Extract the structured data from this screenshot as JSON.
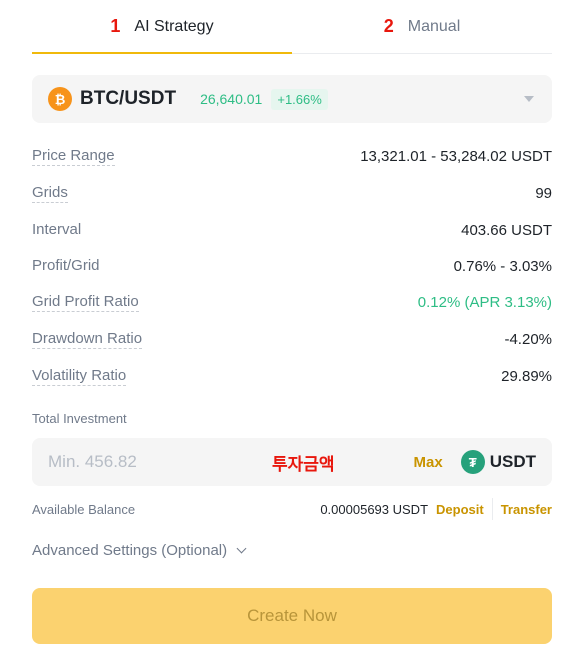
{
  "tabs": [
    {
      "number": "1",
      "label": "AI Strategy",
      "active": true
    },
    {
      "number": "2",
      "label": "Manual",
      "active": false
    }
  ],
  "pair": {
    "coin_icon": "bitcoin-icon",
    "coin_symbol": "₿",
    "name": "BTC/USDT",
    "price": "26,640.01",
    "change": "+1.66%",
    "colors": {
      "up": "#2ebd85",
      "coin": "#f7931a"
    }
  },
  "params": [
    {
      "label": "Price Range",
      "value": "13,321.01 - 53,284.02 USDT",
      "dashed": true,
      "green": false
    },
    {
      "label": "Grids",
      "value": "99",
      "dashed": true,
      "green": false
    },
    {
      "label": "Interval",
      "value": "403.66 USDT",
      "dashed": false,
      "green": false
    },
    {
      "label": "Profit/Grid",
      "value": "0.76% - 3.03%",
      "dashed": false,
      "green": false
    },
    {
      "label": "Grid Profit Ratio",
      "value": "0.12% (APR 3.13%)",
      "dashed": true,
      "green": true
    },
    {
      "label": "Drawdown Ratio",
      "value": "-4.20%",
      "dashed": true,
      "green": false
    },
    {
      "label": "Volatility Ratio",
      "value": "29.89%",
      "dashed": true,
      "green": false
    }
  ],
  "investment": {
    "label": "Total Investment",
    "placeholder": "Min. 456.82",
    "value": "",
    "annotation": "투자금액",
    "max_label": "Max",
    "unit_icon": "tether-icon",
    "unit_symbol": "₮",
    "unit": "USDT"
  },
  "balance": {
    "label": "Available Balance",
    "value": "0.00005693 USDT",
    "deposit_label": "Deposit",
    "transfer_label": "Transfer"
  },
  "advanced": {
    "label": "Advanced Settings (Optional)"
  },
  "create_button": {
    "label": "Create Now"
  },
  "colors": {
    "accent": "#f0b90b",
    "link": "#c99400",
    "annotation": "#e8170d",
    "button_bg": "#fbd26f"
  }
}
